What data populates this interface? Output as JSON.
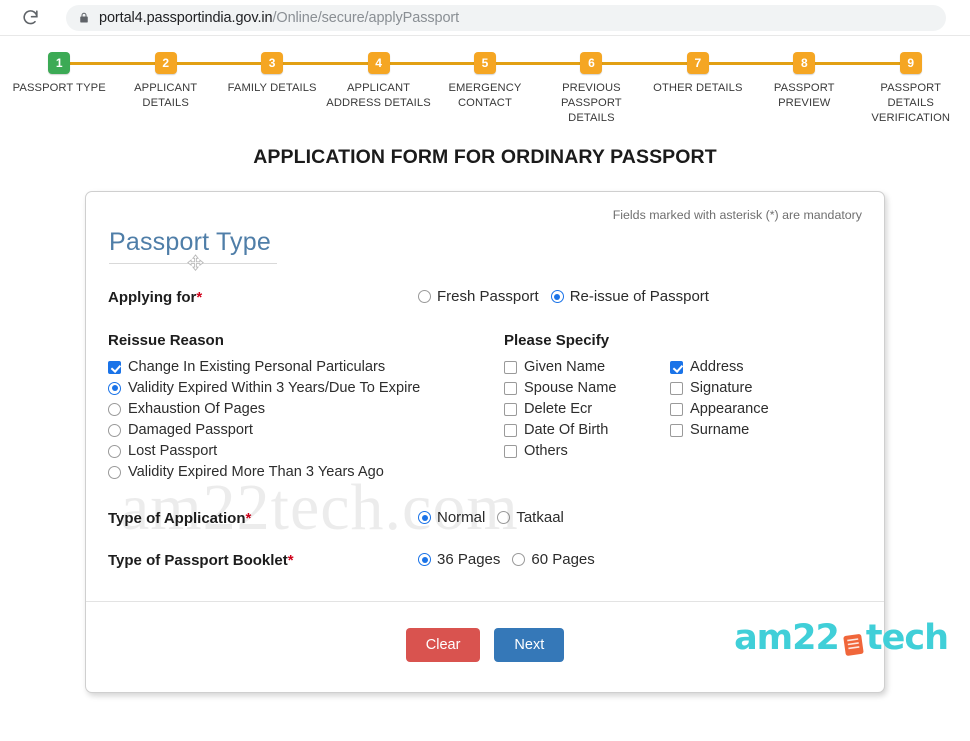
{
  "browser": {
    "reload_icon": "reload-icon",
    "lock_icon": "lock-icon",
    "url_host": "portal4.passportindia.gov.in",
    "url_path": "/Online/secure/applyPassport"
  },
  "stepper": {
    "steps": [
      {
        "number": "1",
        "label": "PASSPORT TYPE",
        "state": "done",
        "color": "#3caa55"
      },
      {
        "number": "2",
        "label": "APPLICANT DETAILS",
        "state": "pending",
        "color": "#f5a623"
      },
      {
        "number": "3",
        "label": "FAMILY DETAILS",
        "state": "pending",
        "color": "#f5a623"
      },
      {
        "number": "4",
        "label": "APPLICANT ADDRESS DETAILS",
        "state": "pending",
        "color": "#f5a623"
      },
      {
        "number": "5",
        "label": "EMERGENCY CONTACT",
        "state": "pending",
        "color": "#f5a623"
      },
      {
        "number": "6",
        "label": "PREVIOUS PASSPORT DETAILS",
        "state": "pending",
        "color": "#f5a623"
      },
      {
        "number": "7",
        "label": "OTHER DETAILS",
        "state": "pending",
        "color": "#f5a623"
      },
      {
        "number": "8",
        "label": "PASSPORT PREVIEW",
        "state": "pending",
        "color": "#f5a623"
      },
      {
        "number": "9",
        "label": "PASSPORT DETAILS VERIFICATION",
        "state": "pending",
        "color": "#f5a623"
      }
    ],
    "connector_color": "#e2a014"
  },
  "page_title": "APPLICATION FORM FOR ORDINARY PASSPORT",
  "card": {
    "mandatory_note": "Fields marked with asterisk (*) are mandatory",
    "section_heading": "Passport Type",
    "cursor_icon": "move-cursor-icon",
    "applying_for": {
      "label": "Applying for",
      "required_mark": "*",
      "options": [
        {
          "label": "Fresh Passport",
          "selected": false
        },
        {
          "label": "Re-issue of Passport",
          "selected": true
        }
      ]
    },
    "reissue_reason": {
      "title": "Reissue Reason",
      "options": [
        {
          "label": "Change In Existing Personal Particulars",
          "control": "checkbox",
          "selected": true
        },
        {
          "label": "Validity Expired Within 3 Years/Due To Expire",
          "control": "radio",
          "selected": true
        },
        {
          "label": "Exhaustion Of Pages",
          "control": "radio",
          "selected": false
        },
        {
          "label": "Damaged Passport",
          "control": "radio",
          "selected": false
        },
        {
          "label": "Lost Passport",
          "control": "radio",
          "selected": false
        },
        {
          "label": "Validity Expired More Than 3 Years Ago",
          "control": "radio",
          "selected": false
        }
      ]
    },
    "please_specify": {
      "title": "Please Specify",
      "column_left": [
        {
          "label": "Given Name",
          "control": "checkbox",
          "selected": false
        },
        {
          "label": "Spouse Name",
          "control": "checkbox",
          "selected": false
        },
        {
          "label": "Delete Ecr",
          "control": "checkbox",
          "selected": false
        },
        {
          "label": "Date Of Birth",
          "control": "checkbox",
          "selected": false
        },
        {
          "label": "Others",
          "control": "checkbox",
          "selected": false
        }
      ],
      "column_right": [
        {
          "label": "Address",
          "control": "checkbox",
          "selected": true
        },
        {
          "label": "Signature",
          "control": "checkbox",
          "selected": false
        },
        {
          "label": "Appearance",
          "control": "checkbox",
          "selected": false
        },
        {
          "label": "Surname",
          "control": "checkbox",
          "selected": false
        }
      ]
    },
    "type_of_application": {
      "label": "Type of Application",
      "required_mark": "*",
      "options": [
        {
          "label": "Normal",
          "selected": true
        },
        {
          "label": "Tatkaal",
          "selected": false
        }
      ]
    },
    "type_of_booklet": {
      "label": "Type of Passport Booklet",
      "required_mark": "*",
      "options": [
        {
          "label": "36 Pages",
          "selected": true
        },
        {
          "label": "60 Pages",
          "selected": false
        }
      ]
    },
    "buttons": {
      "clear": "Clear",
      "next": "Next"
    }
  },
  "watermark": "am22tech.com",
  "logo": {
    "left_text": "am22",
    "right_text": "tech",
    "glyph": "book-icon",
    "text_color": "#40cfd8",
    "glyph_color": "#f0663a"
  }
}
